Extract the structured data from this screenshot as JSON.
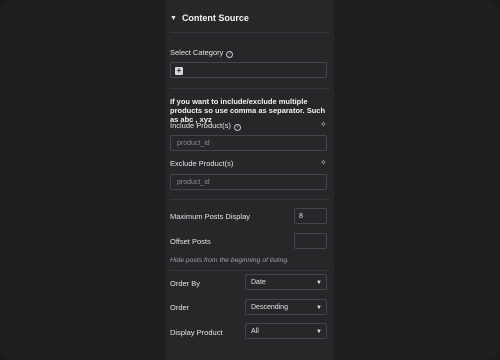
{
  "section": {
    "title": "Content Source",
    "caret_icon": "caret-down-icon"
  },
  "select_category": {
    "label": "Select Category",
    "help_icon": "?",
    "add_button": "+"
  },
  "note": "If you want to include/exclude multiple products so use comma as separator. Such as abc , xyz",
  "include": {
    "label": "Include Product(s)",
    "help_icon": "?",
    "placeholder": "product_id",
    "ai_icon": "✧"
  },
  "exclude": {
    "label": "Exclude Product(s)",
    "placeholder": "product_id",
    "ai_icon": "✧"
  },
  "max_posts": {
    "label": "Maximum Posts Display",
    "value": "8"
  },
  "offset_posts": {
    "label": "Offset Posts",
    "value": "",
    "hint": "Hide posts from the beginning of listing."
  },
  "order_by": {
    "label": "Order By",
    "value": "Date"
  },
  "order": {
    "label": "Order",
    "value": "Descending"
  },
  "display_product": {
    "label": "Display Product",
    "value": "All"
  },
  "colors": {
    "background": "#1f1f22",
    "panel": "#27272a",
    "border": "#44444a",
    "text": "#e4e4e7",
    "muted": "#8b8b92"
  }
}
